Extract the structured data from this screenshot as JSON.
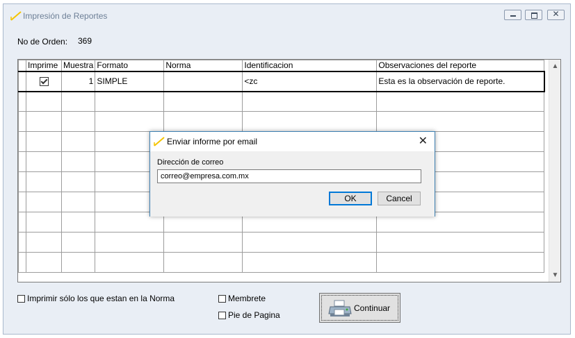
{
  "window": {
    "title": "Impresión de Reportes"
  },
  "order": {
    "label": "No de Orden:",
    "value": "369"
  },
  "grid": {
    "columns": [
      "Imprime",
      "Muestra",
      "Formato",
      "Norma",
      "Identificacion",
      "Observaciones del reporte"
    ],
    "rows": [
      {
        "imprime": true,
        "muestra": "1",
        "formato": "SIMPLE",
        "norma": "",
        "identificacion": "<zc",
        "observaciones": "Esta es la observación de reporte."
      }
    ]
  },
  "options": {
    "solo_norma": "Imprimir sólo los que estan en la Norma",
    "membrete": "Membrete",
    "pie_pagina": "Pie de Pagina"
  },
  "continuar": {
    "label": "Continuar"
  },
  "dialog": {
    "title": "Enviar informe por email",
    "label": "Dirección de correo",
    "email_value": "correo@empresa.com.mx",
    "ok_label": "OK",
    "cancel_label": "Cancel"
  }
}
